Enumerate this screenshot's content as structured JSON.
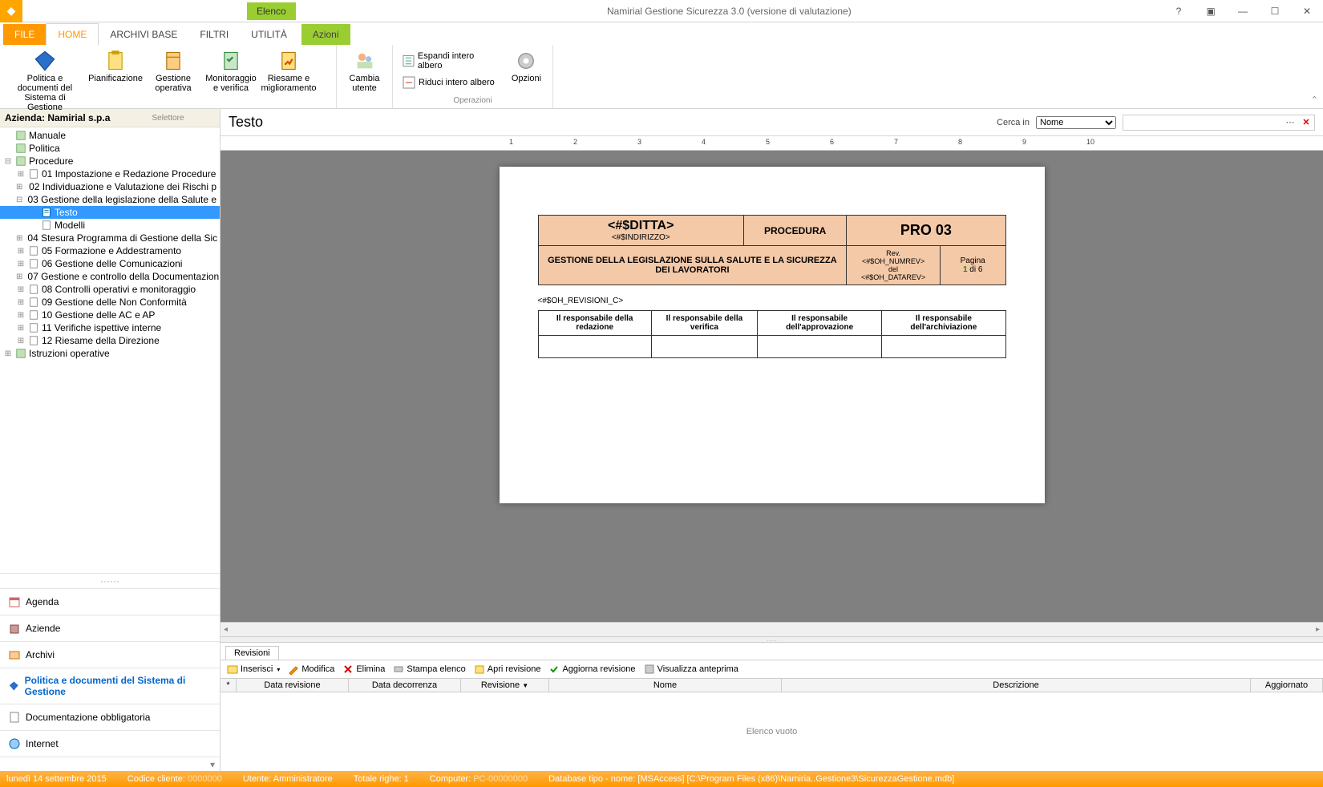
{
  "app": {
    "contextTab": "Elenco",
    "title": "Namirial Gestione Sicurezza 3.0 (versione di valutazione)"
  },
  "ribbonTabs": {
    "file": "FILE",
    "home": "HOME",
    "archivi": "ARCHIVI BASE",
    "filtri": "FILTRI",
    "utilita": "UTILITÀ",
    "azioni": "Azioni"
  },
  "ribbon": {
    "politica": "Politica e documenti del Sistema di Gestione",
    "pianificazione": "Pianificazione",
    "gestione": "Gestione operativa",
    "monitoraggio": "Monitoraggio e verifica",
    "riesame": "Riesame e miglioramento",
    "cambia": "Cambia utente",
    "groupSelettore": "Selettore",
    "opzioni": "Opzioni",
    "espandi": "Espandi intero albero",
    "riduci": "Riduci intero albero",
    "groupOperazioni": "Operazioni"
  },
  "side": {
    "header": "Azienda: Namirial s.p.a",
    "tree": {
      "manuale": "Manuale",
      "politica": "Politica",
      "procedure": "Procedure",
      "p01": "01 Impostazione e Redazione Procedure",
      "p02": "02 Individuazione e Valutazione dei Rischi p",
      "p03": "03 Gestione della legislazione della Salute e",
      "p03testo": "Testo",
      "p03modelli": "Modelli",
      "p04": "04 Stesura Programma di Gestione della Sic",
      "p05": "05 Formazione e Addestramento",
      "p06": "06 Gestione delle Comunicazioni",
      "p07": "07 Gestione e controllo della Documentazion",
      "p08": "08 Controlli operativi e monitoraggio",
      "p09": "09 Gestione delle Non Conformità",
      "p10": "10 Gestione delle AC e AP",
      "p11": "11 Verifiche ispettive interne",
      "p12": "12 Riesame della Direzione",
      "istruzioni": "Istruzioni operative"
    },
    "nav": {
      "agenda": "Agenda",
      "aziende": "Aziende",
      "archivi": "Archivi",
      "politica": "Politica e documenti del Sistema di Gestione",
      "documentazione": "Documentazione obbligatoria",
      "internet": "Internet"
    }
  },
  "content": {
    "title": "Testo",
    "cercaIn": "Cerca in",
    "cercaOption": "Nome"
  },
  "doc": {
    "ditta": "<#$DITTA>",
    "indirizzo": "<#$INDIRIZZO>",
    "procedura": "PROCEDURA",
    "pro03": "PRO 03",
    "gestione": "GESTIONE DELLA LEGISLAZIONE SULLA SALUTE E LA SICUREZZA DEI LAVORATORI",
    "revLabel": "Rev.",
    "numrev": "<#$OH_NUMREV>",
    "del": "del",
    "datarev": "<#$OH_DATAREV>",
    "paginaLabel": "Pagina",
    "paginaCur": "1",
    "paginaSep": " di ",
    "paginaTot": "6",
    "revisioni_c": "<#$OH_REVISIONI_C>",
    "resp1": "Il responsabile della redazione",
    "resp2": "Il responsabile della verifica",
    "resp3": "Il responsabile dell'approvazione",
    "resp4": "Il responsabile dell'archiviazione"
  },
  "rev": {
    "tab": "Revisioni",
    "inserisci": "Inserisci",
    "modifica": "Modifica",
    "elimina": "Elimina",
    "stampa": "Stampa elenco",
    "apri": "Apri revisione",
    "aggiorna": "Aggiorna revisione",
    "anteprima": "Visualizza anteprima",
    "colDataRev": "Data revisione",
    "colDataDec": "Data decorrenza",
    "colRevisione": "Revisione",
    "colNome": "Nome",
    "colDescrizione": "Descrizione",
    "colAggiornato": "Aggiornato",
    "empty": "Elenco vuoto"
  },
  "status": {
    "date": "lunedì 14 settembre 2015",
    "codiceCliente": "Codice cliente:",
    "codiceClienteVal": "0000000",
    "utente": "Utente: Amministratore",
    "righe": "Totale righe: 1",
    "computer": "Computer:",
    "computerVal": "PC-00000000",
    "db": "Database tipo - nome: [MSAccess] [C:\\Program Files (x86)\\Namiria..Gestione3\\SicurezzaGestione.mdb]"
  }
}
